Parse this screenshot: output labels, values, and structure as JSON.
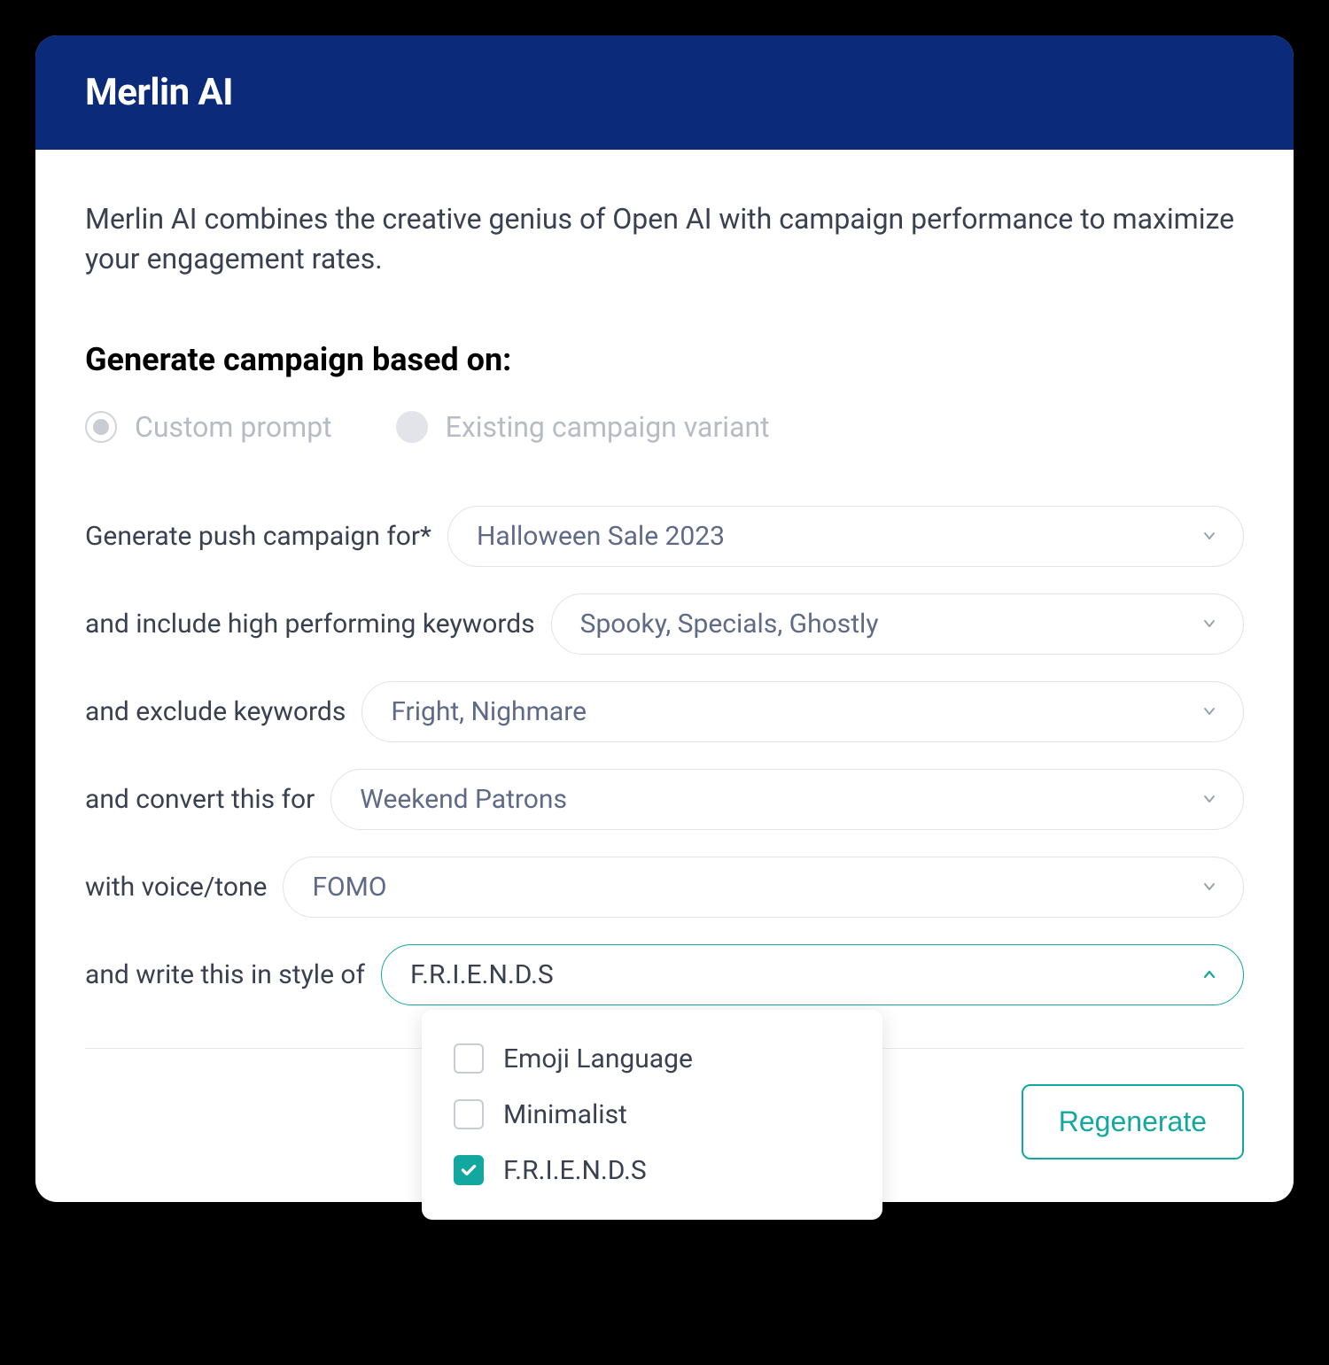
{
  "header": {
    "title": "Merlin AI"
  },
  "intro": "Merlin AI combines the creative genius of Open AI with campaign performance to maximize your engagement rates.",
  "section_title": "Generate campaign based on:",
  "radios": {
    "custom": "Custom prompt",
    "existing": "Existing campaign variant"
  },
  "fields": {
    "campaign_label": "Generate push campaign for*",
    "campaign_value": "Halloween Sale 2023",
    "include_label": "and include high performing keywords",
    "include_value": "Spooky, Specials, Ghostly",
    "exclude_label": "and exclude keywords",
    "exclude_value": "Fright, Nighmare",
    "audience_label": "and convert this for",
    "audience_value": "Weekend Patrons",
    "tone_label": "with voice/tone",
    "tone_value": "FOMO",
    "style_label": "and write this in style of",
    "style_value": "F.R.I.E.N.D.S"
  },
  "style_options": [
    {
      "label": "Emoji Language",
      "checked": false
    },
    {
      "label": "Minimalist",
      "checked": false
    },
    {
      "label": "F.R.I.E.N.D.S",
      "checked": true
    }
  ],
  "actions": {
    "regenerate": "Regenerate"
  },
  "colors": {
    "header_bg": "#0b2a7a",
    "accent": "#12a8a0",
    "muted_text": "#5f6a86"
  }
}
